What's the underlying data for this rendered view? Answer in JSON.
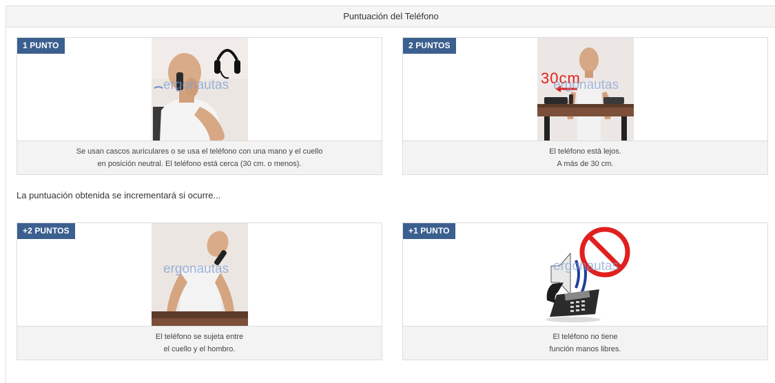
{
  "header": {
    "title": "Puntuación del Teléfono"
  },
  "intro_text": "La puntuación obtenida se incrementará si ocurre...",
  "watermark": "ergonautas",
  "cards": [
    {
      "badge": "1 PUNTO",
      "caption_lines": [
        "Se usan cascos auriculares o se usa el teléfono con una mano y el cuello",
        "en posición neutral. El teléfono está cerca (30 cm. o menos)."
      ]
    },
    {
      "badge": "2 PUNTOS",
      "image_label": "30cm",
      "caption_lines": [
        "El teléfono está lejos.",
        "A más de 30 cm."
      ]
    },
    {
      "badge": "+2 PUNTOS",
      "caption_lines": [
        "El teléfono se sujeta entre",
        "el cuello y el hombro."
      ]
    },
    {
      "badge": "+1 PUNTO",
      "caption_lines": [
        "El teléfono no tiene",
        "función manos libres."
      ]
    }
  ],
  "colors": {
    "badge_bg": "#3b5f8f",
    "header_bg": "#f5f5f5",
    "caption_bg": "#f3f3f3",
    "prohibition_red": "#e0201e"
  }
}
